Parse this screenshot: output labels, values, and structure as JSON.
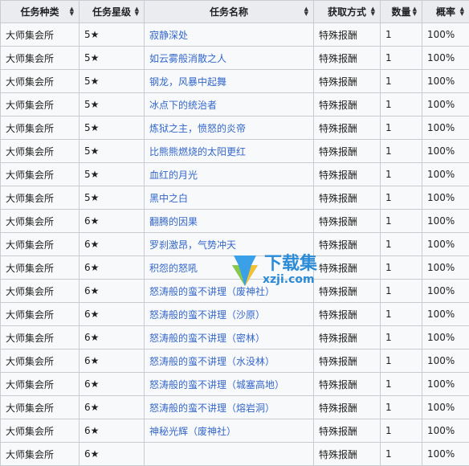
{
  "table": {
    "headers": [
      "任务种类",
      "任务星级",
      "任务名称",
      "获取方式",
      "数量",
      "概率"
    ],
    "rows": [
      [
        "大师集会所",
        "5★",
        "寂静深处",
        "特殊报酬",
        "1",
        "100%"
      ],
      [
        "大师集会所",
        "5★",
        "如云雾般消散之人",
        "特殊报酬",
        "1",
        "100%"
      ],
      [
        "大师集会所",
        "5★",
        "钢龙，风暴中起舞",
        "特殊报酬",
        "1",
        "100%"
      ],
      [
        "大师集会所",
        "5★",
        "冰点下的统治者",
        "特殊报酬",
        "1",
        "100%"
      ],
      [
        "大师集会所",
        "5★",
        "炼狱之主，愤怒的炎帝",
        "特殊报酬",
        "1",
        "100%"
      ],
      [
        "大师集会所",
        "5★",
        "比熊熊燃烧的太阳更红",
        "特殊报酬",
        "1",
        "100%"
      ],
      [
        "大师集会所",
        "5★",
        "血红的月光",
        "特殊报酬",
        "1",
        "100%"
      ],
      [
        "大师集会所",
        "5★",
        "黑中之白",
        "特殊报酬",
        "1",
        "100%"
      ],
      [
        "大师集会所",
        "6★",
        "翻腾的因果",
        "特殊报酬",
        "1",
        "100%"
      ],
      [
        "大师集会所",
        "6★",
        "罗刹激昂，气势冲天",
        "特殊报酬",
        "1",
        "100%"
      ],
      [
        "大师集会所",
        "6★",
        "积怨的怒吼",
        "特殊报酬",
        "1",
        "100%"
      ],
      [
        "大师集会所",
        "6★",
        "怒涛般的蛮不讲理（废神社）",
        "特殊报酬",
        "1",
        "100%"
      ],
      [
        "大师集会所",
        "6★",
        "怒涛般的蛮不讲理（沙原）",
        "特殊报酬",
        "1",
        "100%"
      ],
      [
        "大师集会所",
        "6★",
        "怒涛般的蛮不讲理（密林）",
        "特殊报酬",
        "1",
        "100%"
      ],
      [
        "大师集会所",
        "6★",
        "怒涛般的蛮不讲理（水没林）",
        "特殊报酬",
        "1",
        "100%"
      ],
      [
        "大师集会所",
        "6★",
        "怒涛般的蛮不讲理（城塞高地）",
        "特殊报酬",
        "1",
        "100%"
      ],
      [
        "大师集会所",
        "6★",
        "怒涛般的蛮不讲理（熔岩洞）",
        "特殊报酬",
        "1",
        "100%"
      ],
      [
        "大师集会所",
        "6★",
        "神秘光辉（废神社）",
        "特殊报酬",
        "1",
        "100%"
      ],
      [
        "大师集会所",
        "6★",
        "",
        "特殊报酬",
        "1",
        "100%"
      ]
    ]
  },
  "watermark": {
    "text": "下载集",
    "url": "xzji.com"
  },
  "colors": {
    "link": "#3366cc",
    "header_bg": "#eaecf0",
    "cell_bg": "#f8f9fa",
    "border": "#c8ccd1"
  }
}
